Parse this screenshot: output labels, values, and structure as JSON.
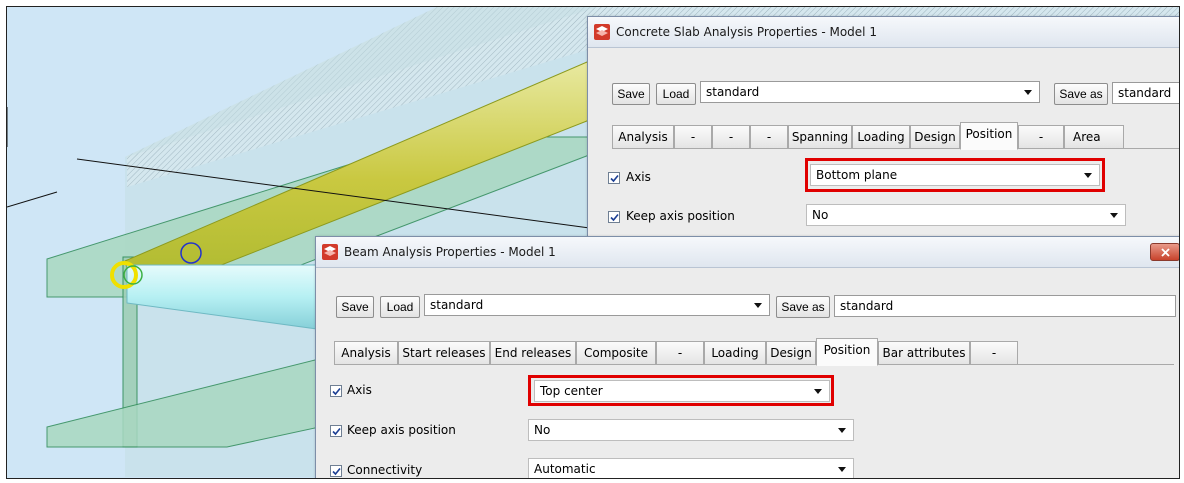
{
  "scene": {
    "colors": {
      "background": "#cfe6f6",
      "beam_fill": "#b3d8c8",
      "beam_edge": "#2e8b57",
      "pipe": "#b6f0f3",
      "rebar": "#d5d95b",
      "node_yellow": "#f0e000",
      "node_green": "#3cb043",
      "node_blue": "#2233cc"
    }
  },
  "slab_dialog": {
    "title": "Concrete Slab Analysis Properties - Model 1",
    "icon": "tekla-app-icon",
    "toolbar": {
      "save_label": "Save",
      "load_label": "Load",
      "preset_value": "standard",
      "save_as_label": "Save as",
      "save_as_value": "standard"
    },
    "tabs": [
      "Analysis",
      "-",
      "-",
      "-",
      "Spanning",
      "Loading",
      "Design",
      "Position",
      "-",
      "Area"
    ],
    "active_tab": "Position",
    "rows": [
      {
        "label": "Axis",
        "checked": true,
        "value": "Bottom plane",
        "highlighted": true
      },
      {
        "label": "Keep axis position",
        "checked": true,
        "value": "No",
        "highlighted": false
      }
    ]
  },
  "beam_dialog": {
    "title": "Beam Analysis Properties - Model 1",
    "icon": "tekla-app-icon",
    "close_icon": "close-icon",
    "toolbar": {
      "save_label": "Save",
      "load_label": "Load",
      "preset_value": "standard",
      "save_as_label": "Save as",
      "save_as_value": "standard"
    },
    "tabs": [
      "Analysis",
      "Start releases",
      "End releases",
      "Composite",
      "-",
      "Loading",
      "Design",
      "Position",
      "Bar attributes",
      "-"
    ],
    "active_tab": "Position",
    "rows": [
      {
        "label": "Axis",
        "checked": true,
        "value": "Top center",
        "highlighted": true
      },
      {
        "label": "Keep axis position",
        "checked": true,
        "value": "No",
        "highlighted": false
      },
      {
        "label": "Connectivity",
        "checked": true,
        "value": "Automatic",
        "highlighted": false
      }
    ]
  },
  "highlight_color": "#e00000"
}
